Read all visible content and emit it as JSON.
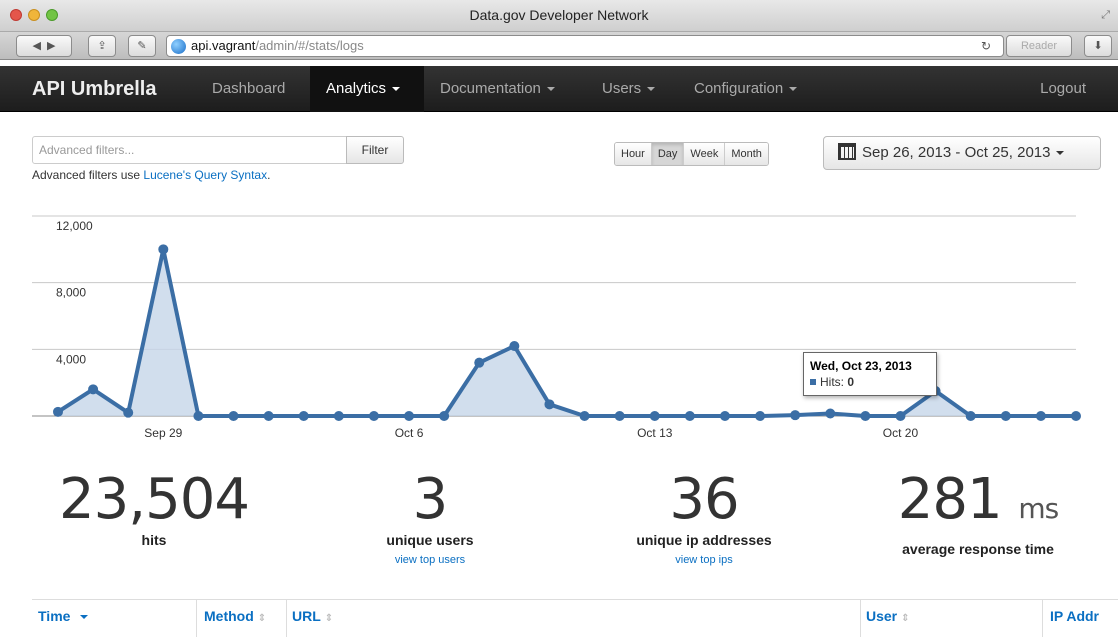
{
  "window": {
    "title": "Data.gov Developer Network",
    "url_host": "api.vagrant",
    "url_path": "/admin/#/stats/logs",
    "reader_label": "Reader"
  },
  "navbar": {
    "brand": "API Umbrella",
    "items": [
      {
        "label": "Dashboard",
        "dropdown": false
      },
      {
        "label": "Analytics",
        "dropdown": true,
        "active": true
      },
      {
        "label": "Documentation",
        "dropdown": true
      },
      {
        "label": "Users",
        "dropdown": true
      },
      {
        "label": "Configuration",
        "dropdown": true
      }
    ],
    "logout": "Logout"
  },
  "filters": {
    "placeholder": "Advanced filters...",
    "button": "Filter",
    "hint_prefix": "Advanced filters use ",
    "hint_link": "Lucene's Query Syntax",
    "hint_suffix": "."
  },
  "intervals": {
    "options": [
      "Hour",
      "Day",
      "Week",
      "Month"
    ],
    "selected": "Day"
  },
  "date_range": "Sep 26, 2013 - Oct 25, 2013",
  "chart_data": {
    "type": "area",
    "series": [
      {
        "name": "Hits",
        "color": "#3b6ea5"
      }
    ],
    "x": [
      "Sep 26",
      "Sep 27",
      "Sep 28",
      "Sep 29",
      "Sep 30",
      "Oct 1",
      "Oct 2",
      "Oct 3",
      "Oct 4",
      "Oct 5",
      "Oct 6",
      "Oct 7",
      "Oct 8",
      "Oct 9",
      "Oct 10",
      "Oct 11",
      "Oct 12",
      "Oct 13",
      "Oct 14",
      "Oct 15",
      "Oct 16",
      "Oct 17",
      "Oct 18",
      "Oct 19",
      "Oct 20",
      "Oct 21",
      "Oct 22",
      "Oct 23",
      "Oct 24",
      "Oct 25"
    ],
    "values": [
      250,
      1600,
      200,
      10000,
      0,
      0,
      0,
      0,
      0,
      0,
      0,
      0,
      3200,
      4200,
      700,
      0,
      0,
      0,
      0,
      0,
      0,
      50,
      150,
      0,
      0,
      1500,
      0,
      0,
      0,
      0
    ],
    "yticks": [
      "12,000",
      "8,000",
      "4,000"
    ],
    "ylim": [
      0,
      12000
    ],
    "xticks": [
      "Sep 29",
      "Oct 6",
      "Oct 13",
      "Oct 20"
    ],
    "grid": true,
    "tooltip": {
      "date": "Wed, Oct 23, 2013",
      "label": "Hits:",
      "value": "0"
    }
  },
  "stats": [
    {
      "number": "23,504",
      "unit": "",
      "label": "hits",
      "link": ""
    },
    {
      "number": "3",
      "unit": "",
      "label": "unique users",
      "link": "view top users"
    },
    {
      "number": "36",
      "unit": "",
      "label": "unique ip addresses",
      "link": "view top ips"
    },
    {
      "number": "281",
      "unit": "ms",
      "label": "average response time",
      "link": ""
    }
  ],
  "table": {
    "columns": [
      "Time",
      "Method",
      "URL",
      "User",
      "IP Addr"
    ]
  }
}
